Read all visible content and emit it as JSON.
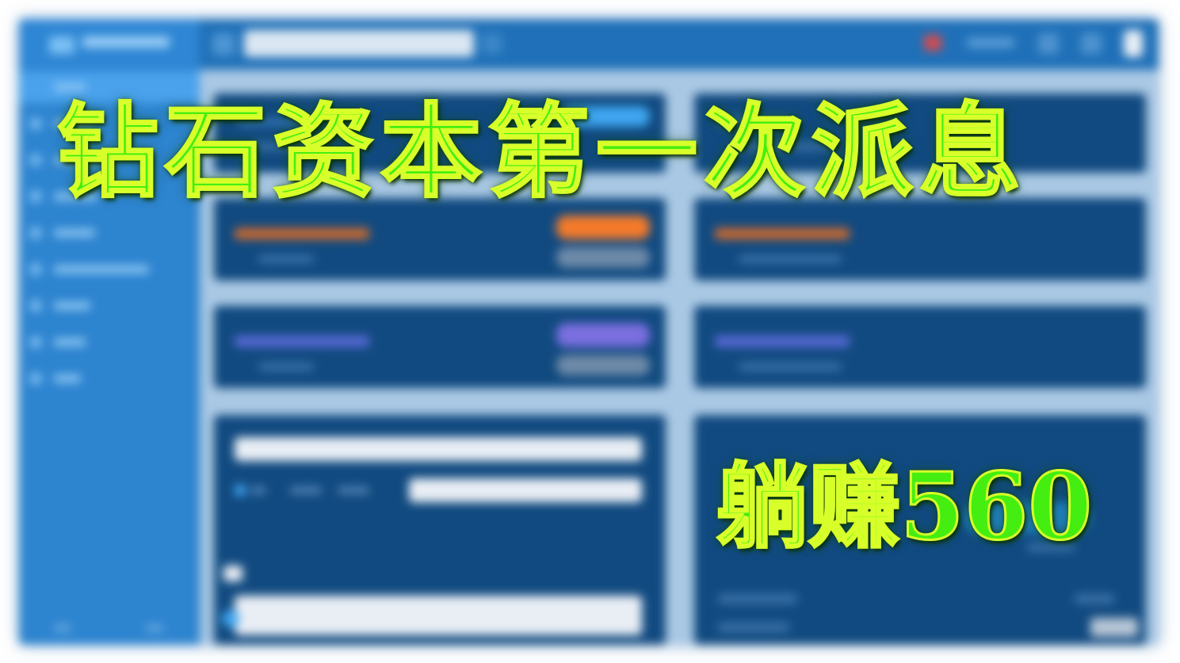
{
  "overlay": {
    "title": "钻石资本第一次派息",
    "subtitle": "躺赚560"
  },
  "colors": {
    "overlay_text": "#44ee10",
    "overlay_outline": "#d8ff2a",
    "topbar": "#1f70b8",
    "sidebar": "#2d84cf",
    "sidebar_active": "#4aa2ec",
    "card": "#114a80",
    "page_bg": "#a9c8e4",
    "badge_orange": "#f47a2a",
    "badge_purple": "#7b6fe0",
    "badge_blue": "#3fa6f0"
  },
  "background_app": {
    "state": "blurred",
    "icons": [
      "logo-icon",
      "menu-icon",
      "search-icon",
      "flag-icon",
      "notification-icon",
      "settings-icon",
      "user-avatar-icon"
    ]
  }
}
